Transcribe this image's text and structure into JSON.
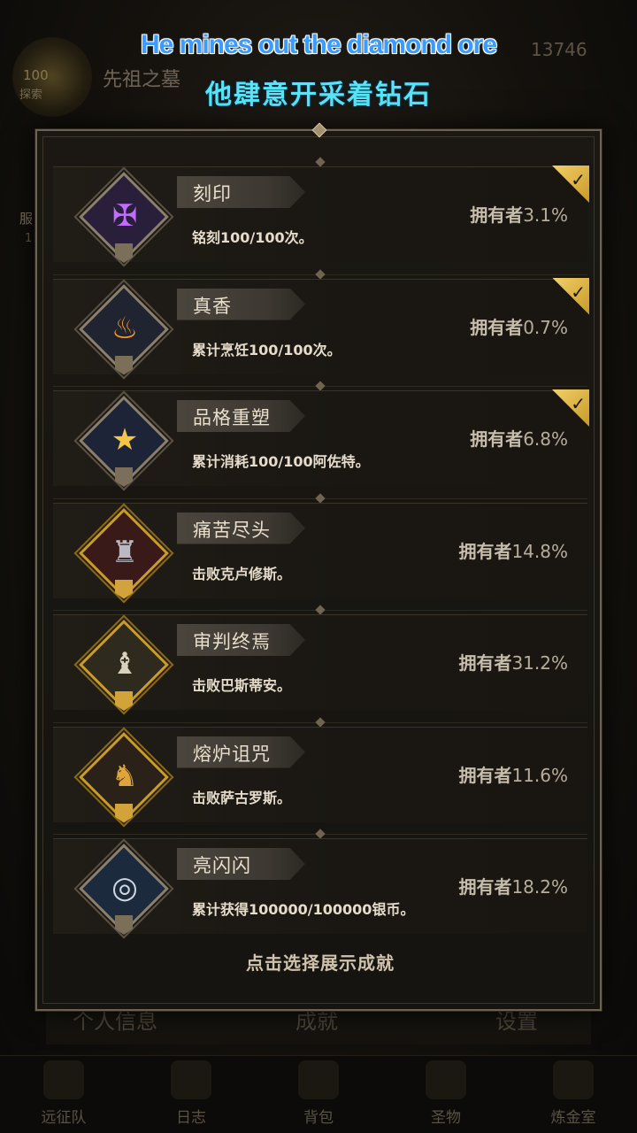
{
  "caption": {
    "english": "He mines out the diamond ore",
    "chinese": "他肆意开采着钻石"
  },
  "background": {
    "level_badge": "100",
    "level_sub": "探索",
    "location_title": "先祖之墓",
    "currency_count": "13746",
    "left_tab": "服",
    "left_tab_sub": "1",
    "profile_tabs": [
      "个人信息",
      "成就",
      "设置"
    ],
    "bottom_nav": [
      {
        "label": "远征队",
        "icon": "helmet-icon"
      },
      {
        "label": "日志",
        "icon": "journal-icon"
      },
      {
        "label": "背包",
        "icon": "backpack-icon"
      },
      {
        "label": "圣物",
        "icon": "relic-icon"
      },
      {
        "label": "炼金室",
        "icon": "alchemy-icon"
      }
    ]
  },
  "achievements": [
    {
      "title": "刻印",
      "desc": "铭刻100/100次。",
      "owner_label": "拥有者",
      "owner_pct": "3.1%",
      "selected": true,
      "frame": "silver",
      "icon": "rune-sigil-icon"
    },
    {
      "title": "真香",
      "desc": "累计烹饪100/100次。",
      "owner_label": "拥有者",
      "owner_pct": "0.7%",
      "selected": true,
      "frame": "silver",
      "icon": "cooking-pot-icon"
    },
    {
      "title": "品格重塑",
      "desc": "累计消耗100/100阿佐特。",
      "owner_label": "拥有者",
      "owner_pct": "6.8%",
      "selected": true,
      "frame": "silver",
      "icon": "gold-star-icon"
    },
    {
      "title": "痛苦尽头",
      "desc": "击败克卢修斯。",
      "owner_label": "拥有者",
      "owner_pct": "14.8%",
      "selected": false,
      "frame": "gold",
      "icon": "spiked-boss-icon"
    },
    {
      "title": "审判终焉",
      "desc": "击败巴斯蒂安。",
      "owner_label": "拥有者",
      "owner_pct": "31.2%",
      "selected": false,
      "frame": "gold",
      "icon": "judge-boss-icon"
    },
    {
      "title": "熔炉诅咒",
      "desc": "击败萨古罗斯。",
      "owner_label": "拥有者",
      "owner_pct": "11.6%",
      "selected": false,
      "frame": "gold",
      "icon": "forge-boss-icon"
    },
    {
      "title": "亮闪闪",
      "desc": "累计获得100000/100000银币。",
      "owner_label": "拥有者",
      "owner_pct": "18.2%",
      "selected": false,
      "frame": "silver",
      "icon": "silver-coins-icon"
    }
  ],
  "footer_hint": "点击选择展示成就",
  "colors": {
    "caption_en": "#3a9cff",
    "caption_zh": "#58e6f6",
    "gold_frame": "#c99b2a",
    "check_gold": "#e0b84a",
    "panel_border": "#6e6350"
  }
}
